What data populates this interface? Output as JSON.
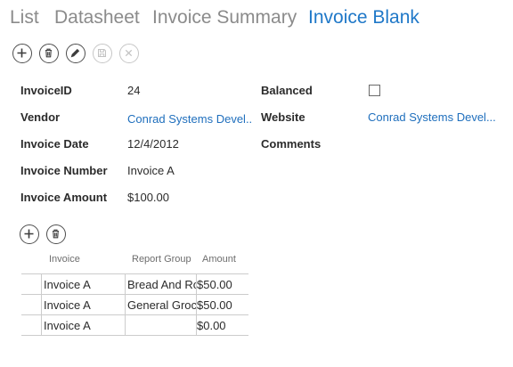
{
  "tabs": [
    {
      "label": "List"
    },
    {
      "label": "Datasheet"
    },
    {
      "label": "Invoice Summary"
    },
    {
      "label": "Invoice Blank",
      "active": true
    }
  ],
  "actions": [
    {
      "name": "add",
      "icon": "plus-icon",
      "enabled": true
    },
    {
      "name": "delete",
      "icon": "trash-icon",
      "enabled": true
    },
    {
      "name": "edit",
      "icon": "pencil-icon",
      "enabled": true
    },
    {
      "name": "save",
      "icon": "save-icon",
      "enabled": false
    },
    {
      "name": "cancel",
      "icon": "close-icon",
      "enabled": false
    }
  ],
  "form": {
    "invoice_id": {
      "label": "InvoiceID",
      "value": "24"
    },
    "vendor": {
      "label": "Vendor",
      "value": "Conrad Systems Devel..."
    },
    "invoice_date": {
      "label": "Invoice Date",
      "value": "12/4/2012"
    },
    "invoice_number": {
      "label": "Invoice Number",
      "value": "Invoice A"
    },
    "invoice_amount": {
      "label": "Invoice Amount",
      "value": "$100.00"
    },
    "balanced": {
      "label": "Balanced",
      "checked": false
    },
    "website": {
      "label": "Website",
      "value": "Conrad Systems Devel..."
    },
    "comments": {
      "label": "Comments",
      "value": ""
    }
  },
  "subgrid": {
    "actions": [
      {
        "name": "add",
        "icon": "plus-icon"
      },
      {
        "name": "delete",
        "icon": "trash-icon"
      }
    ],
    "columns": [
      "Invoice",
      "Report Group",
      "Amount"
    ],
    "rows": [
      {
        "invoice": "Invoice A",
        "report_group": "Bread And Rolls",
        "amount": "$50.00"
      },
      {
        "invoice": "Invoice A",
        "report_group": "General Grocery",
        "amount": "$50.00"
      },
      {
        "invoice": "Invoice A",
        "report_group": "",
        "amount": "$0.00"
      }
    ]
  },
  "colors": {
    "active_tab": "#1f78c8",
    "inactive_tab": "#8b8b8b",
    "link": "#1f6fbd"
  }
}
